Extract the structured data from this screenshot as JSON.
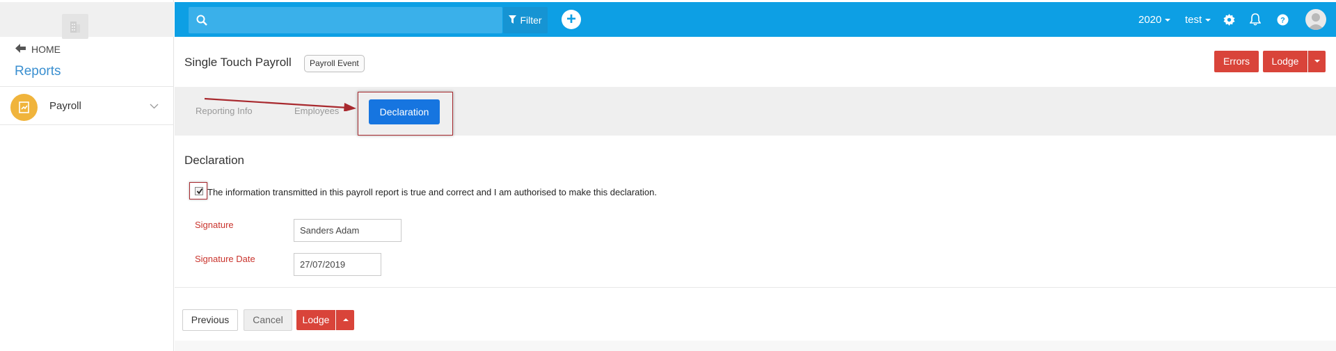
{
  "sidebar": {
    "logo_icon": "building-icon",
    "home_label": "HOME",
    "home_icon": "arrow-left-icon",
    "section_title": "Reports",
    "items": [
      {
        "label": "Payroll",
        "icon": "payroll-report-icon",
        "icon_color": "#f0b43c",
        "expanded": false
      }
    ]
  },
  "topbar": {
    "color": "#0d9fe4",
    "search": {
      "placeholder": "",
      "value": ""
    },
    "filter_label": "Filter",
    "year": "2020",
    "user": "test",
    "icons": [
      "gear-icon",
      "bell-icon",
      "help-icon",
      "avatar"
    ]
  },
  "header": {
    "title": "Single Touch Payroll",
    "badge": "Payroll Event",
    "errors_label": "Errors",
    "lodge_label": "Lodge"
  },
  "tabs": [
    {
      "label": "Reporting Info",
      "active": false
    },
    {
      "label": "Employees",
      "active": false
    },
    {
      "label": "Declaration",
      "active": true
    }
  ],
  "declaration": {
    "title": "Declaration",
    "checkbox_checked": true,
    "statement": "The information transmitted in this payroll report is true and correct and I am authorised to make this declaration.",
    "signature_label": "Signature",
    "signature_value": "Sanders Adam",
    "date_label": "Signature Date",
    "date_value": "27/07/2019"
  },
  "footer": {
    "previous_label": "Previous",
    "cancel_label": "Cancel",
    "lodge_label": "Lodge"
  },
  "colors": {
    "accent": "#1675e0",
    "danger": "#d9443a",
    "annotation": "#a8292e",
    "link": "#3a8fd0"
  }
}
